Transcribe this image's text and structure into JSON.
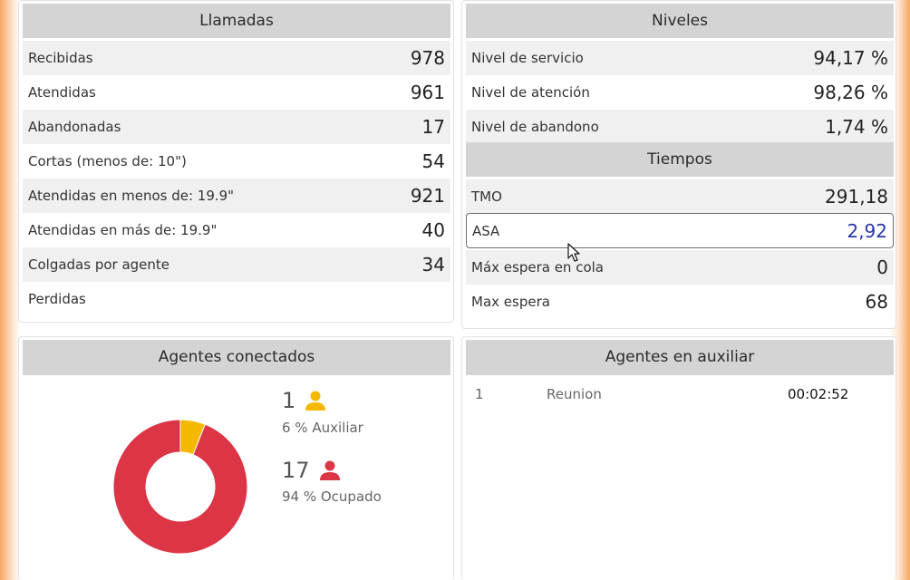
{
  "llamadas": {
    "title": "Llamadas",
    "rows": [
      {
        "label": "Recibidas",
        "value": "978"
      },
      {
        "label": "Atendidas",
        "value": "961"
      },
      {
        "label": "Abandonadas",
        "value": "17"
      },
      {
        "label": "Cortas (menos de: 10\")",
        "value": "54"
      },
      {
        "label": "Atendidas en menos de: 19.9\"",
        "value": "921"
      },
      {
        "label": "Atendidas en más de: 19.9\"",
        "value": "40"
      },
      {
        "label": "Colgadas por agente",
        "value": "34"
      },
      {
        "label": "Perdidas",
        "value": ""
      }
    ]
  },
  "niveles": {
    "title": "Niveles",
    "rows": [
      {
        "label": "Nivel de servicio",
        "value": "94,17 %"
      },
      {
        "label": "Nivel de atención",
        "value": "98,26 %"
      },
      {
        "label": "Nivel de abandono",
        "value": "1,74 %"
      }
    ]
  },
  "tiempos": {
    "title": "Tiempos",
    "rows": [
      {
        "label": "TMO",
        "value": "291,18"
      },
      {
        "label": "ASA",
        "value": "2,92"
      },
      {
        "label": "Máx espera en cola",
        "value": "0"
      },
      {
        "label": "Max espera",
        "value": "68"
      }
    ]
  },
  "agentes_conectados": {
    "title": "Agentes conectados",
    "auxiliar": {
      "count": "1",
      "text": "6 % Auxiliar",
      "percent": 6,
      "color": "#f5b800"
    },
    "ocupado": {
      "count": "17",
      "text": "94 % Ocupado",
      "percent": 94,
      "color": "#dc3545"
    }
  },
  "agentes_auxiliar": {
    "title": "Agentes en auxiliar",
    "rows": [
      {
        "num": "1",
        "motivo": "Reunion",
        "tiempo": "00:02:52"
      }
    ]
  },
  "colors": {
    "header_bg": "#d4d4d4",
    "highlight_value": "#2a37a6",
    "accent_orange": "#f7a866"
  }
}
